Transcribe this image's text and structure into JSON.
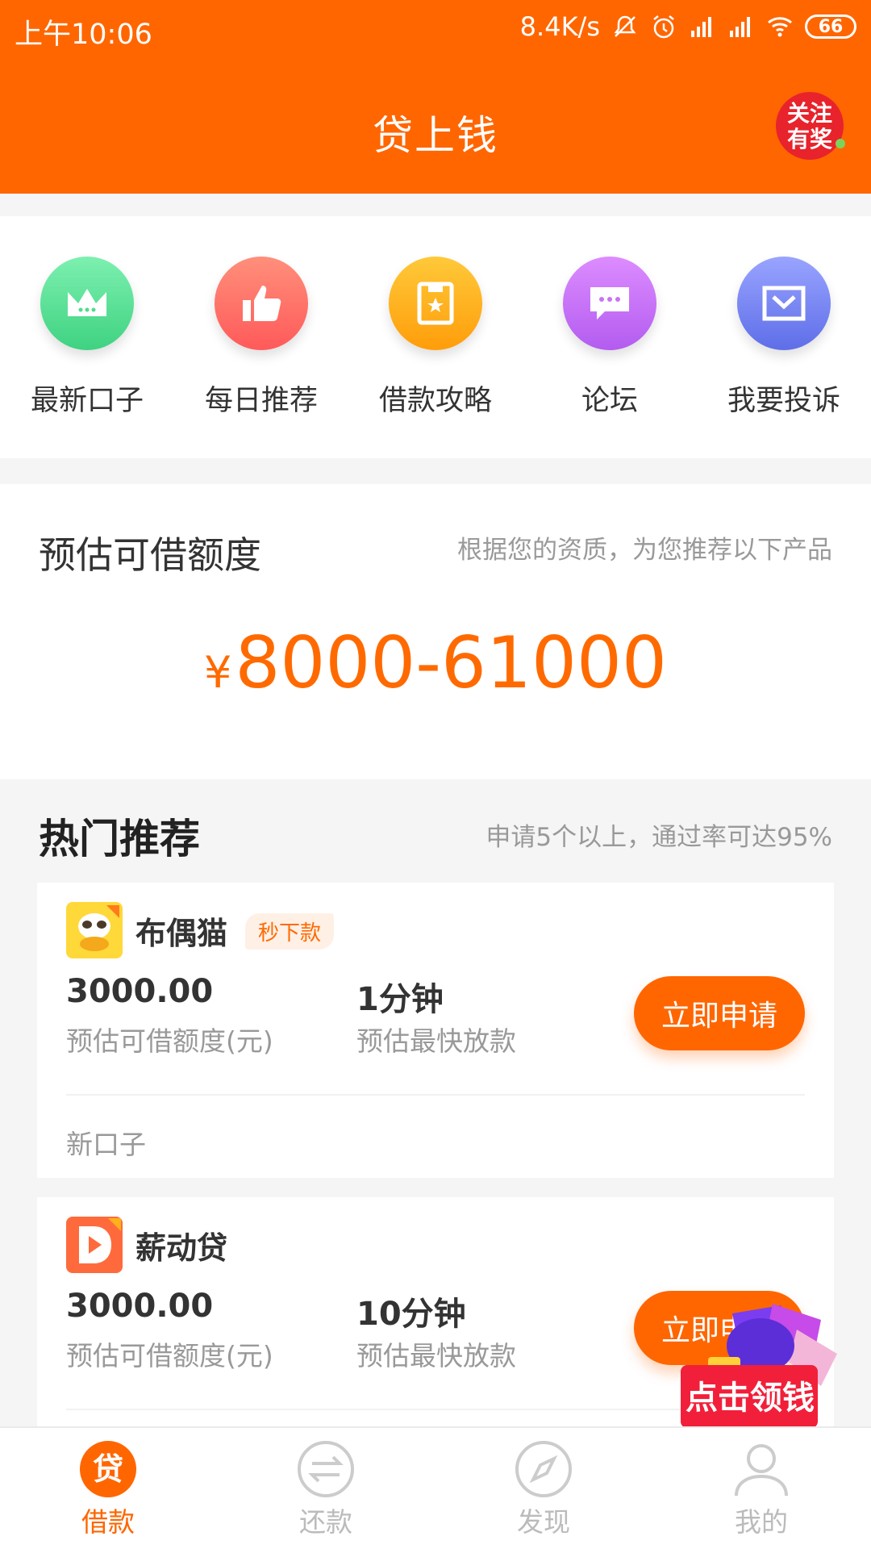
{
  "status_bar": {
    "time": "上午10:06",
    "net_speed": "8.4K/s",
    "battery": "66"
  },
  "header": {
    "title": "贷上钱",
    "promo_badge": "关注有奖",
    "color": "#ff6600"
  },
  "quick_nav": [
    {
      "label": "最新口子",
      "icon": "crown-icon",
      "color": "#4fdc8f"
    },
    {
      "label": "每日推荐",
      "icon": "thumbs-up-icon",
      "color": "#ff6a6a"
    },
    {
      "label": "借款攻略",
      "icon": "book-star-icon",
      "color": "#ffac1c"
    },
    {
      "label": "论坛",
      "icon": "chat-bubble-icon",
      "color": "#c873f5"
    },
    {
      "label": "我要投诉",
      "icon": "envelope-icon",
      "color": "#7a86f0"
    }
  ],
  "estimate": {
    "title": "预估可借额度",
    "subtitle": "根据您的资质，为您推荐以下产品",
    "currency": "¥",
    "amount": "8000-61000"
  },
  "hot": {
    "title": "热门推荐",
    "subtitle": "申请5个以上，通过率可达95%"
  },
  "products": [
    {
      "name": "布偶猫",
      "tag": "秒下款",
      "amount": "3000.00",
      "amount_label": "预估可借额度(元)",
      "speed": "1分钟",
      "speed_label": "预估最快放款",
      "button": "立即申请",
      "note": "新口子"
    },
    {
      "name": "薪动贷",
      "tag": "",
      "amount": "3000.00",
      "amount_label": "预估可借额度(元)",
      "speed": "10分钟",
      "speed_label": "预估最快放款",
      "button": "立即申请",
      "note": ""
    }
  ],
  "float_promo": {
    "label": "点击领钱"
  },
  "bottom_nav": [
    {
      "label": "借款",
      "icon": "loan-icon",
      "active": true
    },
    {
      "label": "还款",
      "icon": "repay-icon",
      "active": false
    },
    {
      "label": "发现",
      "icon": "compass-icon",
      "active": false
    },
    {
      "label": "我的",
      "icon": "user-icon",
      "active": false
    }
  ]
}
